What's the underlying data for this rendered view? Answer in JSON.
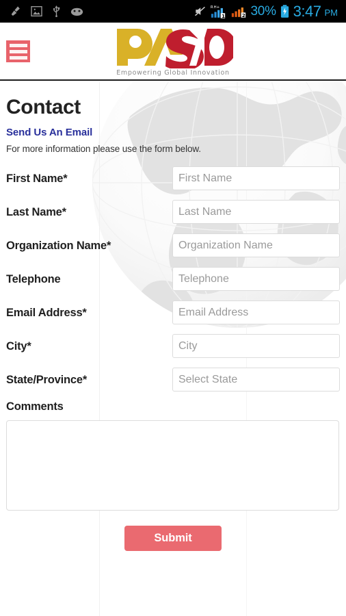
{
  "statusbar": {
    "left_icons": [
      {
        "name": "broom-cleaner-icon"
      },
      {
        "name": "gallery-image-icon"
      },
      {
        "name": "usb-icon"
      },
      {
        "name": "android-robot-icon"
      }
    ],
    "mute_icon": "volume-muted-icon",
    "sim1_signal": {
      "icon": "signal-bars-sim1-icon",
      "label": "1",
      "network": "R H+"
    },
    "sim2_signal": {
      "icon": "signal-bars-sim2-icon",
      "label": "2"
    },
    "battery_percent": "30%",
    "battery_icon": "battery-charging-icon",
    "time": "3:47",
    "ampm": "PM"
  },
  "appbar": {
    "menu_icon": "hamburger-menu-icon",
    "logo": {
      "name": "pasd-logo",
      "text": "PASD",
      "part_gold": "PA",
      "part_red": "SD",
      "tagline": "Empowering Global Innovation",
      "gold": "#d9b128",
      "red": "#bf1e2e"
    }
  },
  "page": {
    "title": "Contact",
    "subtitle": "Send Us An Email",
    "intro": "For more information please use the form below.",
    "watermark_icon": "globe-watermark"
  },
  "form": {
    "fields": [
      {
        "label": "First Name",
        "required": true,
        "placeholder": "First Name",
        "value": "",
        "name": "first-name",
        "type": "text"
      },
      {
        "label": "Last Name",
        "required": true,
        "placeholder": "Last Name",
        "value": "",
        "name": "last-name",
        "type": "text"
      },
      {
        "label": "Organization Name",
        "required": true,
        "placeholder": "Organization Name",
        "value": "",
        "name": "organization-name",
        "type": "text"
      },
      {
        "label": "Telephone",
        "required": false,
        "placeholder": "Telephone",
        "value": "",
        "name": "telephone",
        "type": "tel"
      },
      {
        "label": "Email Address",
        "required": true,
        "placeholder": "Email Address",
        "value": "",
        "name": "email-address",
        "type": "email"
      },
      {
        "label": "City",
        "required": true,
        "placeholder": "City",
        "value": "",
        "name": "city",
        "type": "text"
      },
      {
        "label": "State/Province",
        "required": true,
        "placeholder": "Select State",
        "value": "",
        "name": "state-province",
        "type": "select"
      }
    ],
    "required_marker": "*",
    "comments": {
      "label": "Comments",
      "required": false,
      "placeholder": "",
      "value": "",
      "name": "comments"
    },
    "submit_label": "Submit",
    "submit_color": "#ea6a70",
    "accent_blue": "#29309b"
  }
}
